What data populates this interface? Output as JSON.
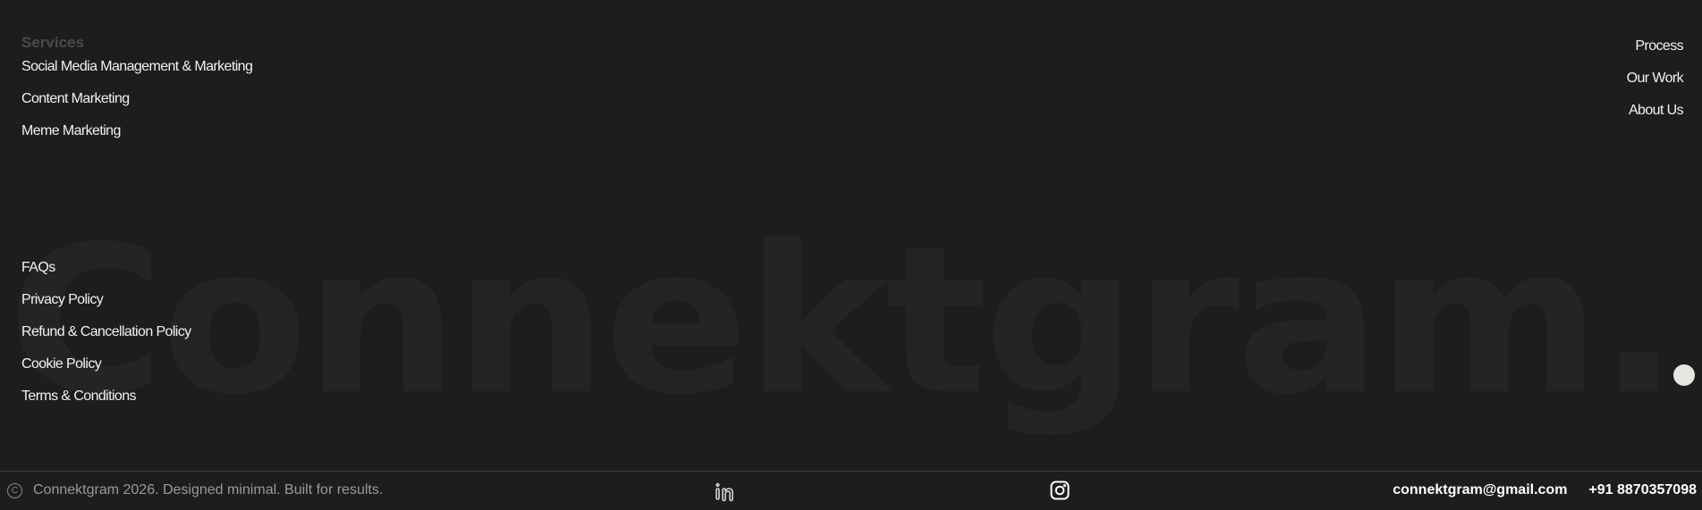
{
  "brand": {
    "watermark": "Connektgram."
  },
  "services": {
    "heading": "Services",
    "items": [
      "Social Media Management & Marketing",
      "Content Marketing",
      "Meme Marketing"
    ]
  },
  "right_nav": {
    "items": [
      "Process",
      "Our Work",
      "About Us"
    ]
  },
  "legal": {
    "items": [
      "FAQs",
      "Privacy Policy",
      "Refund & Cancellation Policy",
      "Cookie Policy",
      "Terms & Conditions"
    ]
  },
  "footer": {
    "copyright_symbol": "C",
    "copyright_text": "Connektgram 2026. Designed minimal. Built for results.",
    "email": "connektgram@gmail.com",
    "phone": "+91 8870357098",
    "icons": [
      "linkedin-icon",
      "instagram-icon"
    ]
  },
  "colors": {
    "background": "#1d1d1d",
    "watermark": "#242424",
    "text": "#f2f2f2",
    "muted": "#9a9a9a",
    "dot": "#e6e6e1"
  }
}
